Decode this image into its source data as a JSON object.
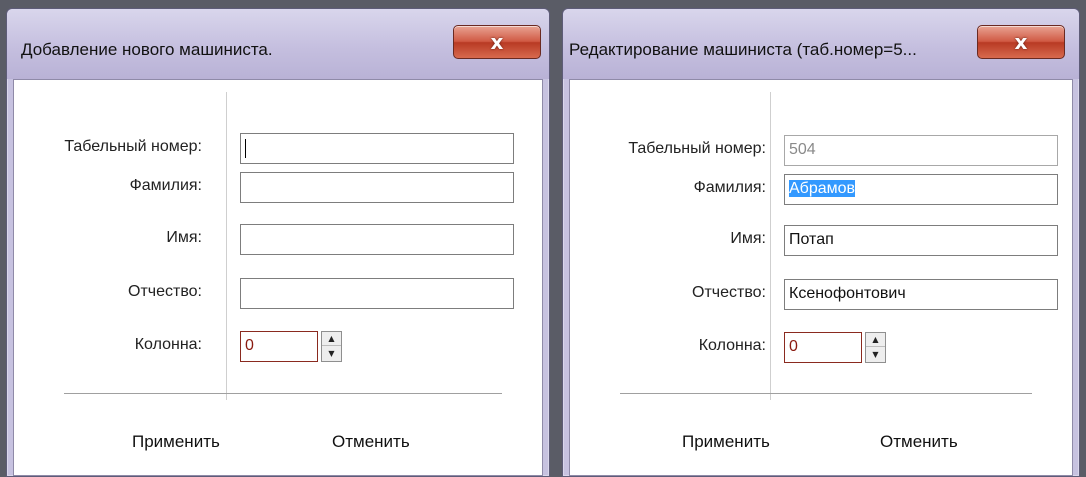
{
  "add_dialog": {
    "title": "Добавление нового машиниста.",
    "close_label": "x",
    "labels": {
      "tab_number": "Табельный номер:",
      "surname": "Фамилия:",
      "name": "Имя:",
      "patronymic": "Отчество:",
      "column": "Колонна:"
    },
    "values": {
      "tab_number": "",
      "surname": "",
      "name": "",
      "patronymic": "",
      "column": "0"
    },
    "spin_up": "▲",
    "spin_down": "▼",
    "apply": "Применить",
    "cancel": "Отменить"
  },
  "edit_dialog": {
    "title": "Редактирование машиниста (таб.номер=5...",
    "close_label": "x",
    "labels": {
      "tab_number": "Табельный номер:",
      "surname": "Фамилия:",
      "name": "Имя:",
      "patronymic": "Отчество:",
      "column": "Колонна:"
    },
    "values": {
      "tab_number": "504",
      "surname": "Абрамов",
      "name": "Потап",
      "patronymic": "Ксенофонтович",
      "column": "0"
    },
    "spin_up": "▲",
    "spin_down": "▼",
    "apply": "Применить",
    "cancel": "Отменить"
  },
  "colors": {
    "frame": "#c7c2e0",
    "close_button": "#d05a44",
    "selection": "#3399ff",
    "spin_value": "#8a1a10"
  }
}
